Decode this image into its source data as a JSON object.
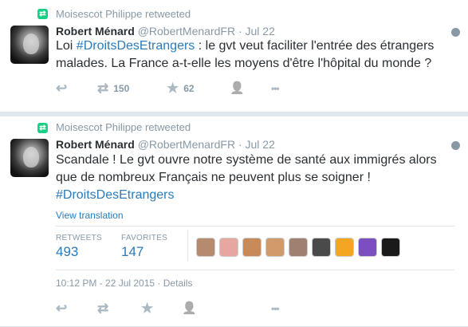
{
  "tweets": [
    {
      "retweeted_by": "Moisescot Philippe retweeted",
      "author_name": "Robert Ménard",
      "author_handle": "@RobertMenardFR",
      "sep": "·",
      "time": "Jul 22",
      "text_before": "Loi ",
      "hashtag": "#DroitsDesEtrangers",
      "text_after": " : le gvt veut faciliter l'entrée des étrangers malades. La France a-t-elle les moyens d'être l'hôpital du monde ?",
      "retweet_count": "150",
      "favorite_count": "62"
    },
    {
      "retweeted_by": "Moisescot Philippe retweeted",
      "author_name": "Robert Ménard",
      "author_handle": "@RobertMenardFR",
      "sep": "·",
      "time": "Jul 22",
      "text_line1": "Scandale ! Le gvt ouvre notre système de santé aux immigrés alors",
      "text_line2": "que de nombreux Français ne peuvent plus se soigner !",
      "hashtag": "#DroitsDesEtrangers",
      "view_translation": "View translation",
      "retweets_label": "RETWEETS",
      "retweets_value": "493",
      "favorites_label": "FAVORITES",
      "favorites_value": "147",
      "timestamp": "10:12 PM - 22 Jul 2015",
      "details_sep": "·",
      "details": "Details",
      "favoriter_colors": [
        "#b58a6e",
        "#e8a6a0",
        "#c98a5a",
        "#d19a6b",
        "#a08070",
        "#4a4a4a",
        "#f4a623",
        "#7b4fbf",
        "#1a1a1a"
      ]
    }
  ],
  "icons": {
    "reply": "↩",
    "retweet": "⇄",
    "favorite": "★",
    "follow": "👤",
    "more": "•••"
  }
}
